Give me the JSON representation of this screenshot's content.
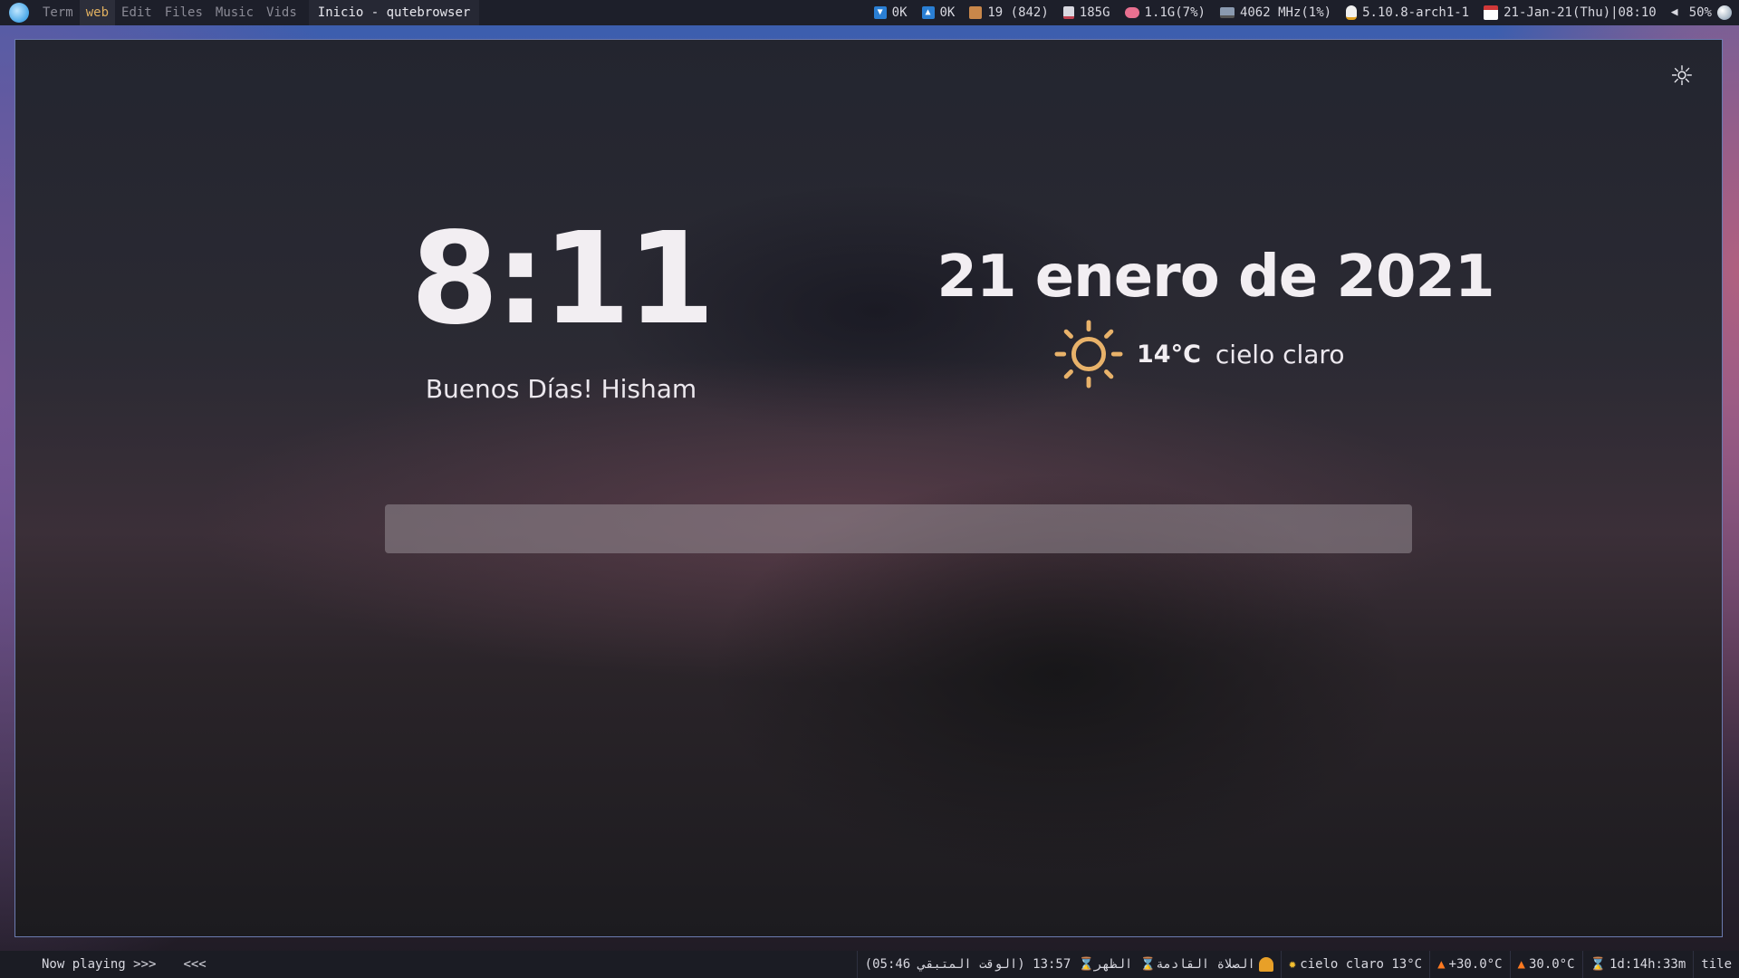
{
  "topbar": {
    "workspaces": [
      "Term",
      "web",
      "Edit",
      "Files",
      "Music",
      "Vids"
    ],
    "active_workspace": "web",
    "window_title": "Inicio - qutebrowser",
    "net_down": "0K",
    "net_up": "0K",
    "updates": "19 (842)",
    "disk": "185G",
    "memory": "1.1G(7%)",
    "cpu": "4062 MHz(1%)",
    "kernel": "5.10.8-arch1-1",
    "datetime": "21-Jan-21(Thu)|08:10",
    "volume": "50%"
  },
  "page": {
    "clock": "8:11",
    "greeting": "Buenos Días! Hisham",
    "date": "21 enero de 2021",
    "temperature": "14°C",
    "condition": "cielo claro",
    "search_value": "",
    "accent": "#e8b26a"
  },
  "bottombar": {
    "now_playing": "Now playing >>>",
    "prev_label": "<<<",
    "prayer_remaining": "(الوقت المتبقي 05:46)",
    "prayer_time": "13:57",
    "prayer_name": "الظهر",
    "prayer_label": "الصلاة القادمة",
    "weather": "cielo claro 13°C",
    "temp1": "+30.0°C",
    "temp2": "30.0°C",
    "uptime": "1d:14h:33m",
    "layout": "tile"
  }
}
